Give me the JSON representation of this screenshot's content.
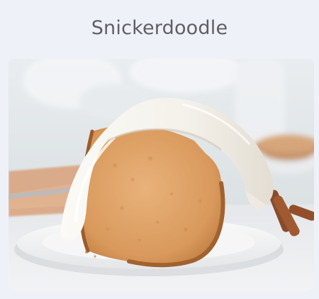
{
  "product": {
    "name": "Snickerdoodle",
    "image_icon": "bundt-cake-slice-image"
  }
}
